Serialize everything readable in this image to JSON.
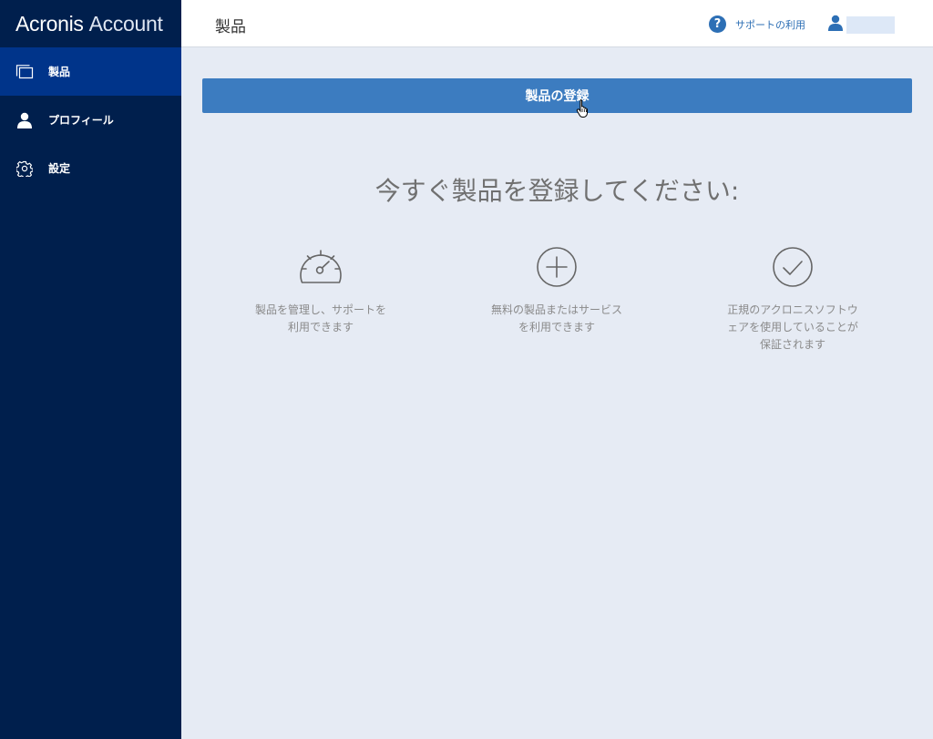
{
  "brand": {
    "part1": "Acronis",
    "part2": "Account"
  },
  "sidebar": {
    "items": [
      {
        "label": "製品",
        "icon": "products-icon",
        "active": true
      },
      {
        "label": "プロフィール",
        "icon": "user-icon",
        "active": false
      },
      {
        "label": "設定",
        "icon": "gear-icon",
        "active": false
      }
    ]
  },
  "header": {
    "title": "製品",
    "support_label": "サポートの利用",
    "user_name": ""
  },
  "main": {
    "register_button": "製品の登録",
    "headline": "今すぐ製品を登録してください:",
    "features": [
      {
        "icon": "speedometer-icon",
        "text": "製品を管理し、サポートを利用できます"
      },
      {
        "icon": "plus-circle-icon",
        "text": "無料の製品またはサービスを利用できます"
      },
      {
        "icon": "check-circle-icon",
        "text": "正規のアクロニスソフトウェアを使用していることが保証されます"
      }
    ]
  },
  "colors": {
    "sidebar_bg": "#001f4d",
    "sidebar_active": "#00348a",
    "accent": "#3c7cc0",
    "content_bg": "#e6ebf4"
  }
}
